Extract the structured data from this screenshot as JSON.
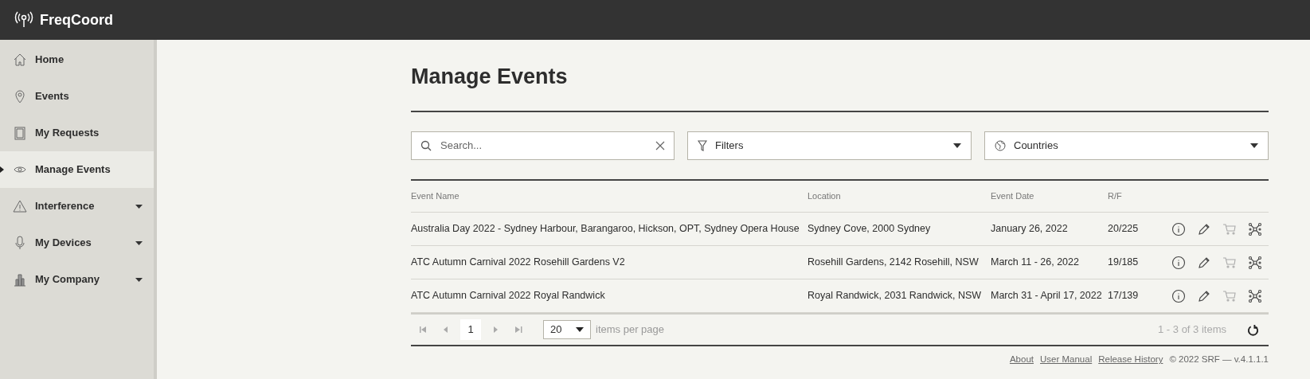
{
  "app": {
    "title": "FreqCoord"
  },
  "sidebar": {
    "items": [
      {
        "label": "Home",
        "selected": false,
        "expandable": false
      },
      {
        "label": "Events",
        "selected": false,
        "expandable": false
      },
      {
        "label": "My Requests",
        "selected": false,
        "expandable": false
      },
      {
        "label": "Manage Events",
        "selected": true,
        "expandable": false
      },
      {
        "label": "Interference",
        "selected": false,
        "expandable": true
      },
      {
        "label": "My Devices",
        "selected": false,
        "expandable": true
      },
      {
        "label": "My Company",
        "selected": false,
        "expandable": true
      }
    ]
  },
  "page": {
    "title": "Manage Events"
  },
  "search": {
    "placeholder": "Search..."
  },
  "filters": {
    "label": "Filters"
  },
  "countries": {
    "label": "Countries"
  },
  "table": {
    "columns": [
      "Event Name",
      "Location",
      "Event Date",
      "R/F"
    ],
    "rows": [
      {
        "name": "Australia Day 2022 - Sydney Harbour, Barangaroo, Hickson, OPT, Sydney Opera House",
        "location": "Sydney Cove, 2000 Sydney",
        "date": "January 26, 2022",
        "rf": "20/225"
      },
      {
        "name": "ATC Autumn Carnival 2022 Rosehill Gardens V2",
        "location": "Rosehill Gardens, 2142 Rosehill, NSW",
        "date": "March 11 - 26, 2022",
        "rf": "19/185"
      },
      {
        "name": "ATC Autumn Carnival 2022 Royal Randwick",
        "location": "Royal Randwick, 2031 Randwick, NSW",
        "date": "March 31 - April 17, 2022",
        "rf": "17/139"
      }
    ]
  },
  "pager": {
    "page": "1",
    "page_size": "20",
    "page_size_label": "items per page",
    "summary": "1 - 3 of 3 items"
  },
  "footer": {
    "links": [
      "About",
      "User Manual",
      "Release History"
    ],
    "copyright": "© 2022 SRF — v.4.1.1.1"
  }
}
